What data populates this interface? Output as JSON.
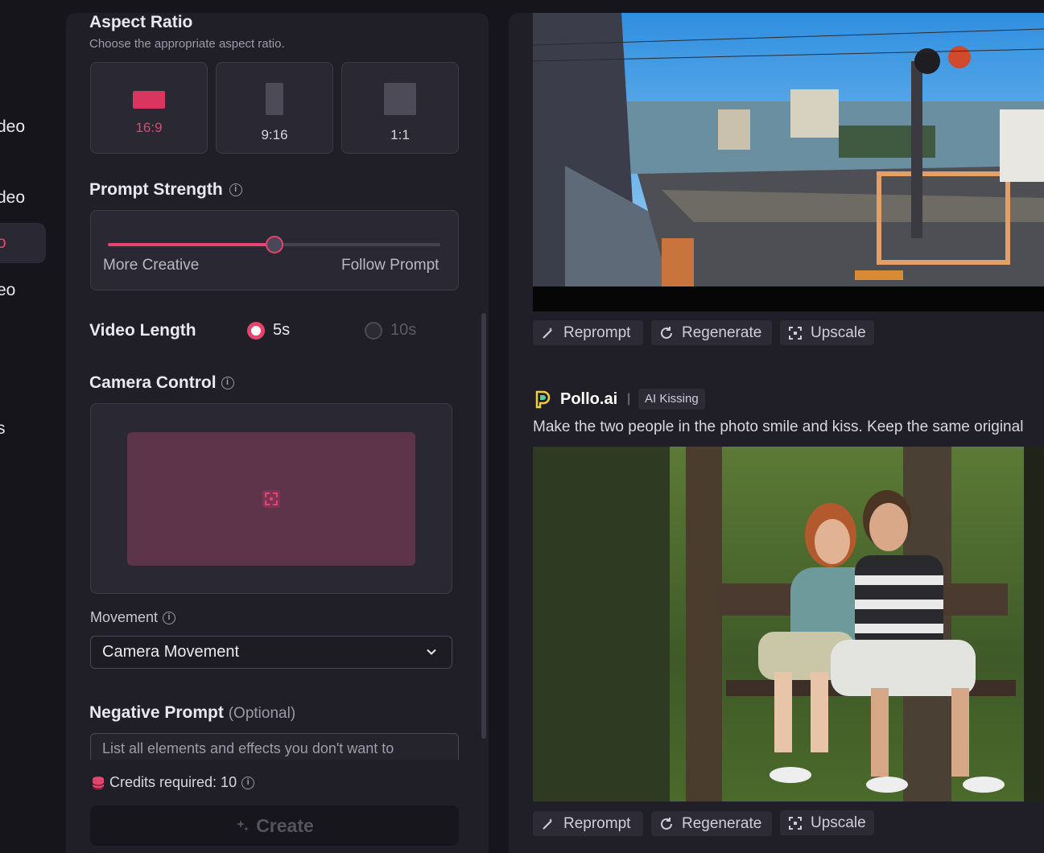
{
  "nav": {
    "items": [
      {
        "label": "deo"
      },
      {
        "label": "deo"
      },
      {
        "label": "o"
      },
      {
        "label": "eo"
      },
      {
        "label": "s"
      }
    ]
  },
  "aspect_ratio": {
    "title": "Aspect Ratio",
    "subtitle": "Choose the appropriate aspect ratio.",
    "options": [
      {
        "label": "16:9",
        "selected": true
      },
      {
        "label": "9:16",
        "selected": false
      },
      {
        "label": "1:1",
        "selected": false
      }
    ]
  },
  "prompt_strength": {
    "title": "Prompt Strength",
    "left_label": "More Creative",
    "right_label": "Follow Prompt",
    "value_fraction": 0.5
  },
  "video_length": {
    "title": "Video Length",
    "options": [
      {
        "label": "5s",
        "selected": true
      },
      {
        "label": "10s",
        "selected": false
      }
    ]
  },
  "camera_control": {
    "title": "Camera Control"
  },
  "movement": {
    "label": "Movement",
    "selected": "Camera Movement"
  },
  "negative_prompt": {
    "title": "Negative Prompt",
    "optional": "(Optional)",
    "placeholder": "List all elements and effects you don't want to"
  },
  "credits": {
    "text": "Credits required: 10"
  },
  "create": {
    "label": "Create"
  },
  "feed": {
    "actions": {
      "reprompt": "Reprompt",
      "regenerate": "Regenerate",
      "upscale": "Upscale"
    },
    "item2": {
      "brand": "Pollo.ai",
      "separator": "|",
      "tag": "AI Kissing",
      "prompt": "Make the two people in the photo smile and kiss. Keep the same original"
    }
  },
  "colors": {
    "accent": "#e8436c",
    "panel": "#201f27",
    "background": "#16151c"
  }
}
